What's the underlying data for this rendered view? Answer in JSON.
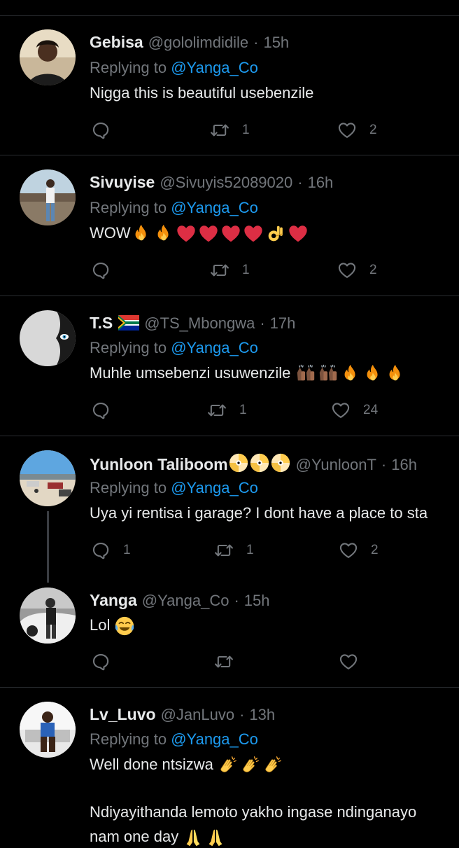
{
  "tweets": [
    {
      "name": "Gebisa",
      "handle": "@gololimdidile",
      "separator": "·",
      "time": "15h",
      "replying_prefix": "Replying to",
      "replying_handle": "@Yanga_Co",
      "text": "Nigga this is beautiful usebenzile",
      "reply_count": "",
      "retweet_count": "1",
      "like_count": "2"
    },
    {
      "name": "Sivuyise",
      "handle": "@Sivuyis52089020",
      "separator": "·",
      "time": "16h",
      "replying_prefix": "Replying to",
      "replying_handle": "@Yanga_Co",
      "text": "WOW",
      "emojis": [
        "fire",
        "fire",
        "heart",
        "heart",
        "heart",
        "heart",
        "ok-hand",
        "heart"
      ],
      "reply_count": "",
      "retweet_count": "1",
      "like_count": "2"
    },
    {
      "name": "T.S",
      "name_flag": "south-africa-flag",
      "handle": "@TS_Mbongwa",
      "separator": "·",
      "time": "17h",
      "replying_prefix": "Replying to",
      "replying_handle": "@Yanga_Co",
      "text": "Muhle umsebenzi usuwenzile",
      "emojis": [
        "raising-hands",
        "raising-hands",
        "fire",
        "fire",
        "fire"
      ],
      "reply_count": "",
      "retweet_count": "1",
      "like_count": "24"
    },
    {
      "name": "Yunloon Taliboom",
      "name_badges": [
        "dvd-disc",
        "dvd-disc",
        "dvd-disc"
      ],
      "handle": "@YunloonT",
      "separator": "·",
      "time": "16h",
      "replying_prefix": "Replying to",
      "replying_handle": "@Yanga_Co",
      "text": "Uya yi rentisa i garage?  I dont have a place to sta",
      "reply_count": "1",
      "retweet_count": "1",
      "like_count": "2"
    },
    {
      "name": "Yanga",
      "handle": "@Yanga_Co",
      "separator": "·",
      "time": "15h",
      "text": "Lol",
      "emojis": [
        "face-with-tears-of-joy"
      ],
      "reply_count": "",
      "retweet_count": "",
      "like_count": ""
    },
    {
      "name": "Lv_Luvo",
      "handle": "@JanLuvo",
      "separator": "·",
      "time": "13h",
      "replying_prefix": "Replying to",
      "replying_handle": "@Yanga_Co",
      "text": "Well done ntsizwa",
      "emojis": [
        "clapping-hands",
        "clapping-hands",
        "clapping-hands"
      ],
      "text_line2": "Ndiyayithanda lemoto yakho ingase ndinganayo",
      "text_line3": "nam one day",
      "emojis_line3": [
        "folded-hands",
        "folded-hands"
      ]
    }
  ],
  "colors": {
    "background": "#000000",
    "primary_text": "#e7e9ea",
    "secondary_text": "#72767b",
    "link": "#1d9bf0",
    "divider": "#2a2d31"
  },
  "icons": {
    "reply": "reply-icon",
    "retweet": "retweet-icon",
    "like": "heart-icon"
  }
}
